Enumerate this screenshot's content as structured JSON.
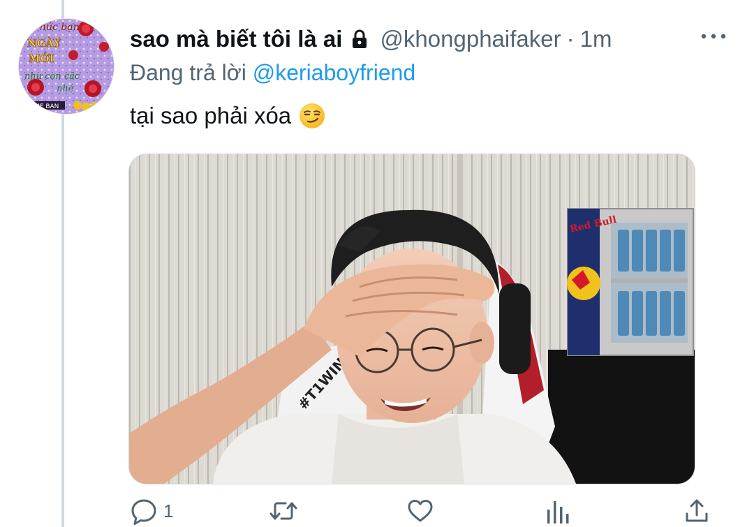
{
  "tweet": {
    "display_name": "sao mà biết tôi là ai",
    "handle": "@khongphaifaker",
    "separator": "·",
    "time": "1m",
    "reply_prefix": "Đang trả lời",
    "reply_to": "@keriaboyfriend",
    "text": "tại sao phải xóa",
    "emoji": "smirking-face",
    "reply_count": "1"
  },
  "avatar": {
    "lines": [
      "húc bạn",
      "NGÀY",
      "MỚI",
      "như con cặc",
      "nhé",
      "ME BAN"
    ]
  },
  "media": {
    "chair_text": "#T1WIN",
    "fridge_brand": "Red Bull"
  },
  "icons": {
    "lock": "lock-icon",
    "more": "more-icon",
    "reply": "reply-icon",
    "retweet": "retweet-icon",
    "like": "heart-icon",
    "analytics": "analytics-icon",
    "share": "share-icon"
  },
  "colors": {
    "link": "#1d9bf0",
    "secondary_text": "#536471",
    "primary_text": "#0f1419",
    "thread_line": "#cfd9de"
  }
}
